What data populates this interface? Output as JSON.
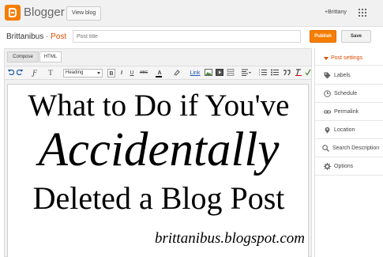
{
  "topbar": {
    "logo_text": "Blogger",
    "view_blog": "View blog",
    "user": "+Brittany"
  },
  "titlebar": {
    "blog_name": "Brittanibus",
    "separator": "·",
    "post_label": "Post",
    "title_placeholder": "Post title",
    "publish": "Publish",
    "save": "Save"
  },
  "editor": {
    "tabs": [
      "Compose",
      "HTML"
    ],
    "toolbar": {
      "font_glyph": "Ƒ",
      "size_glyph": "T",
      "heading": "Heading",
      "bold": "B",
      "italic": "I",
      "underline": "U",
      "strike": "ABC",
      "text_color": "A",
      "link": "Link"
    },
    "content": {
      "line1": "What to Do if You've",
      "line2": "Accidentally",
      "line3": "Deleted a Blog Post",
      "url": "brittanibus.blogspot.com"
    }
  },
  "sidebar": {
    "header": "Post settings",
    "items": [
      "Labels",
      "Schedule",
      "Permalink",
      "Location",
      "Search Description",
      "Options"
    ]
  },
  "colors": {
    "accent": "#f57d00",
    "link_orange": "#dd4b00"
  }
}
